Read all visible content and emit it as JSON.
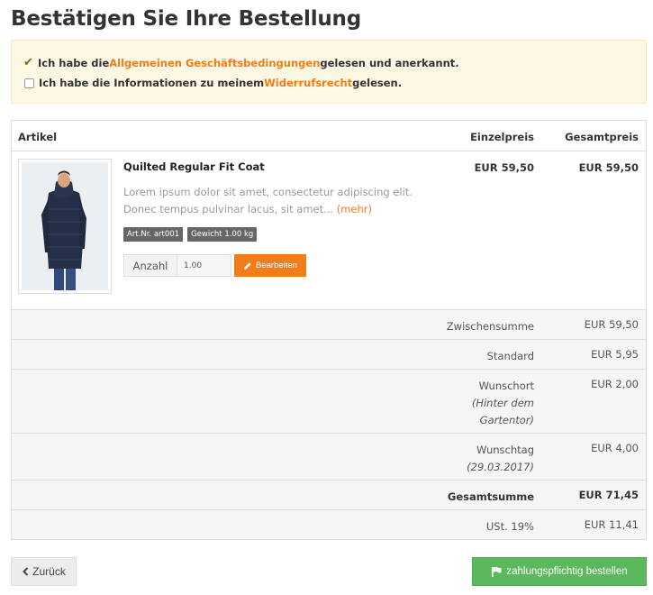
{
  "page": {
    "title": "Bestätigen Sie Ihre Bestellung"
  },
  "conditions": {
    "agb": {
      "pre": "Ich habe die ",
      "link": "Allgemeinen Geschäftsbedingungen",
      "post": " gelesen und anerkannt.",
      "checked": true
    },
    "widerruf": {
      "pre": "Ich habe die Informationen zu meinem ",
      "link": "Widerrufsrecht",
      "post": " gelesen.",
      "checked": false
    }
  },
  "table": {
    "headers": {
      "artikel": "Artikel",
      "einzelpreis": "Einzelpreis",
      "gesamtpreis": "Gesamtpreis"
    },
    "item": {
      "name": "Quilted Regular Fit Coat",
      "description": "Lorem ipsum dolor sit amet, consectetur adipiscing elit. Donec tempus pulvinar lacus, sit amet... ",
      "more_label": "(mehr)",
      "sku_badge": "Art.Nr. art001",
      "weight_badge": "Gewicht 1.00 kg",
      "qty_label": "Anzahl",
      "qty_value": "1.00",
      "edit_label": "Bearbeiten",
      "unit_price": "EUR 59,50",
      "total_price": "EUR 59,50"
    },
    "summary": {
      "zwischensumme": {
        "label": "Zwischensumme",
        "value": "EUR 59,50"
      },
      "standard": {
        "label": "Standard",
        "value": "EUR 5,95"
      },
      "wunschort": {
        "label": "Wunschort",
        "detail_1": "(Hinter dem",
        "detail_2": "Gartentor)",
        "value": "EUR 2,00"
      },
      "wunschtag": {
        "label": "Wunschtag",
        "detail": "(29.03.2017)",
        "value": "EUR 4,00"
      },
      "gesamtsumme": {
        "label": "Gesamtsumme",
        "value": "EUR 71,45"
      },
      "ust": {
        "label": "USt. 19%",
        "value": "EUR 11,41"
      }
    }
  },
  "actions": {
    "back_label": "Zurück",
    "order_label": "zahlungspflichtig bestellen"
  },
  "colors": {
    "accent": "#f07d1a",
    "success": "#5cb85c",
    "notice_bg": "#fcf8e3",
    "summary_bg": "#f6f6f6"
  },
  "icons": {
    "check": "check-icon",
    "pencil": "pencil-icon",
    "back": "chevron-left-icon",
    "flag": "flag-icon"
  }
}
